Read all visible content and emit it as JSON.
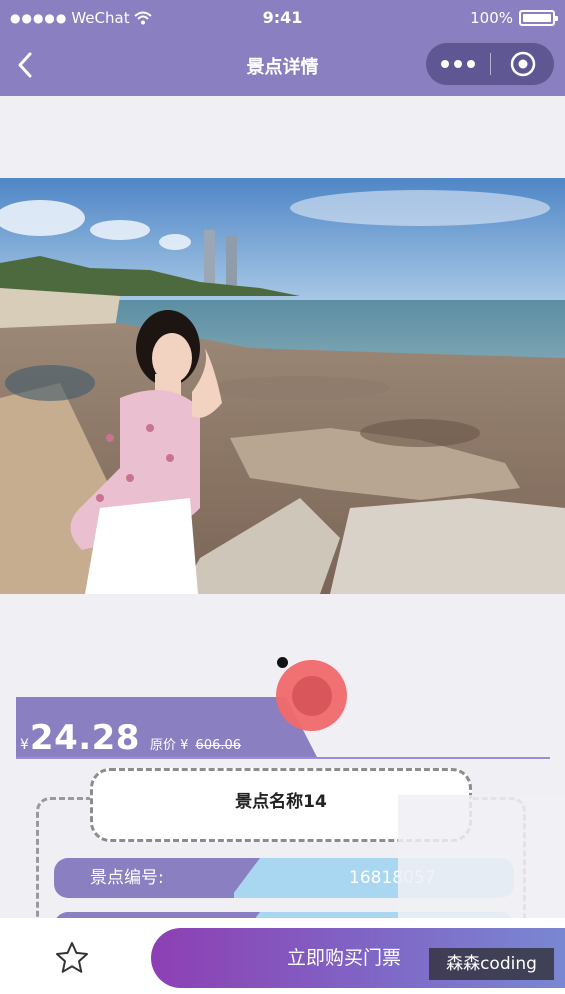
{
  "status_bar": {
    "carrier": "WeChat",
    "time": "9:41",
    "battery": "100%"
  },
  "nav": {
    "title": "景点详情"
  },
  "price": {
    "currency": "¥",
    "current": "24.28",
    "original_label": "原价",
    "original_currency": "¥",
    "original": "606.06"
  },
  "spot": {
    "name": "景点名称14",
    "number_label": "景点编号:",
    "number_value": "16818057"
  },
  "footer": {
    "buy_label": "立即购买门票"
  },
  "watermark": "森森coding",
  "colors": {
    "primary": "#8a7fc0",
    "accent_blue": "#a9d6f0",
    "buy_gradient_start": "#8d3fb3",
    "buy_gradient_end": "#7a87d2"
  }
}
